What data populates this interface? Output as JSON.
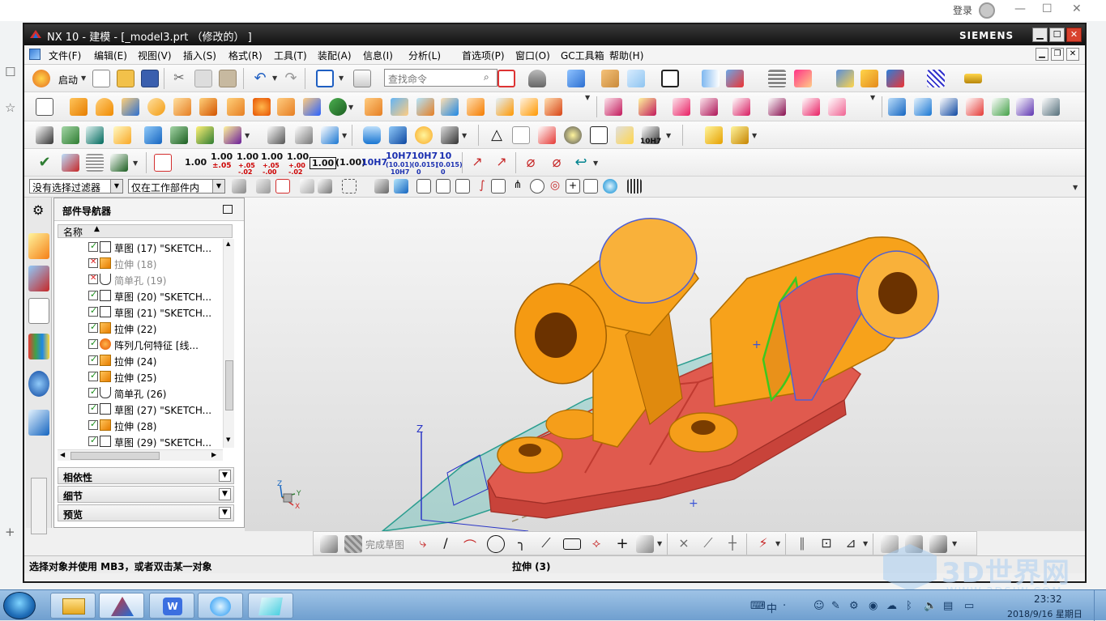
{
  "browser": {
    "login_label": "登录"
  },
  "window": {
    "title": "NX 10 - 建模 - [_model3.prt （修改的） ]",
    "brand": "SIEMENS",
    "controls": [
      "minimize",
      "maximize",
      "close"
    ]
  },
  "menubar": {
    "items": [
      "文件(F)",
      "编辑(E)",
      "视图(V)",
      "插入(S)",
      "格式(R)",
      "工具(T)",
      "装配(A)",
      "信息(I)",
      "分析(L)",
      "首选项(P)",
      "窗口(O)",
      "GC工具箱",
      "帮助(H)"
    ]
  },
  "toolbar": {
    "start_label": "启动",
    "search_placeholder": "查找命令",
    "dim_labels": [
      "1.00",
      "1.00",
      "±.05",
      "1.00",
      "+.05",
      "-.02",
      "1.00",
      "+.05",
      "-.00",
      "1.00",
      "+.00",
      "-.02",
      "1.00",
      "(1.00)",
      "10H7",
      "10H7",
      "(10.01)",
      "10",
      "10H7",
      "(0.015)",
      "0",
      "10",
      "(0.015)",
      "0"
    ],
    "fit_label": "10H7"
  },
  "filterbar": {
    "filter_value": "没有选择过滤器",
    "scope_value": "仅在工作部件内"
  },
  "navigator": {
    "title": "部件导航器",
    "column_header": "名称",
    "rows": [
      {
        "label": "草图 (17) \"SKETCH...",
        "state": "on",
        "kind": "sketch"
      },
      {
        "label": "拉伸 (18)",
        "state": "x",
        "kind": "extrude",
        "dim": true
      },
      {
        "label": "简单孔 (19)",
        "state": "x",
        "kind": "hole",
        "dim": true
      },
      {
        "label": "草图 (20) \"SKETCH...",
        "state": "on",
        "kind": "sketch"
      },
      {
        "label": "草图 (21) \"SKETCH...",
        "state": "on",
        "kind": "sketch"
      },
      {
        "label": "拉伸 (22)",
        "state": "on",
        "kind": "extrude"
      },
      {
        "label": "阵列几何特征 [线...",
        "state": "on",
        "kind": "pattern"
      },
      {
        "label": "拉伸 (24)",
        "state": "on",
        "kind": "extrude"
      },
      {
        "label": "拉伸 (25)",
        "state": "on",
        "kind": "extrude"
      },
      {
        "label": "简单孔 (26)",
        "state": "on",
        "kind": "hole"
      },
      {
        "label": "草图 (27) \"SKETCH...",
        "state": "on",
        "kind": "sketch"
      },
      {
        "label": "拉伸 (28)",
        "state": "on",
        "kind": "extrude"
      },
      {
        "label": "草图 (29) \"SKETCH...",
        "state": "on",
        "kind": "sketch"
      }
    ],
    "panels": [
      "相依性",
      "细节",
      "预览"
    ]
  },
  "viewport": {
    "axis_labels": {
      "z": "Z",
      "x": "X",
      "y": "Y"
    }
  },
  "sketchbar": {
    "finish_label": "完成草图"
  },
  "statusbar": {
    "message": "选择对象并使用 MB3，或者双击某一对象",
    "feature": "拉伸 (3)"
  },
  "taskbar": {
    "time": "23:32",
    "date": "2018/9/16 星期日",
    "ime": "中"
  },
  "watermark": {
    "text": "3D世界网",
    "url": "WWW.3DSJW.COM"
  },
  "colors": {
    "model_orange": "#f7a21b",
    "model_red": "#e0544c",
    "sketch_green": "#3cc81e",
    "title_bar": "#1a1a1a",
    "close_red": "#d8422e"
  }
}
